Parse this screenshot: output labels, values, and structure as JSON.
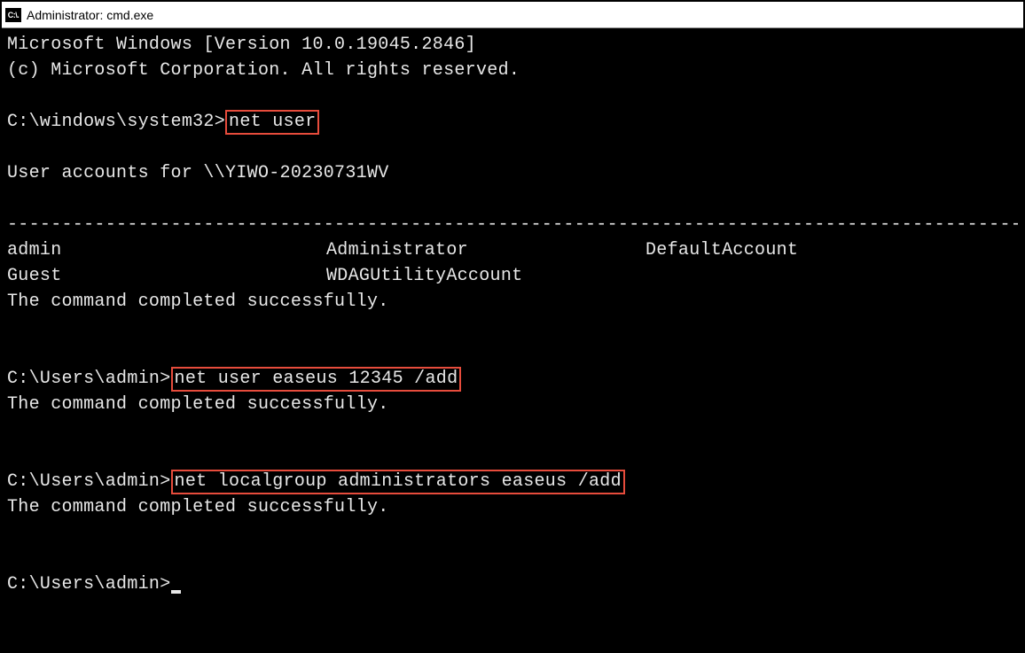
{
  "titlebar": {
    "icon_text": "C:\\.",
    "title": "Administrator: cmd.exe"
  },
  "terminal": {
    "version_line": "Microsoft Windows [Version 10.0.19045.2846]",
    "copyright_line": "(c) Microsoft Corporation. All rights reserved.",
    "prompt1_path": "C:\\windows\\system32>",
    "cmd1": "net user",
    "accounts_header": "User accounts for \\\\YIWO-20230731WV",
    "dashes": "-------------------------------------------------------------------------------------------------------",
    "user_r1c1": "admin",
    "user_r1c2": "Administrator",
    "user_r1c3": "DefaultAccount",
    "user_r2c1": "Guest",
    "user_r2c2": "WDAGUtilityAccount",
    "success_msg": "The command completed successfully.",
    "prompt2_path": "C:\\Users\\admin>",
    "cmd2": "net user easeus 12345 /add",
    "prompt3_path": "C:\\Users\\admin>",
    "cmd3": "net localgroup administrators easeus /add",
    "prompt4_path": "C:\\Users\\admin>"
  }
}
